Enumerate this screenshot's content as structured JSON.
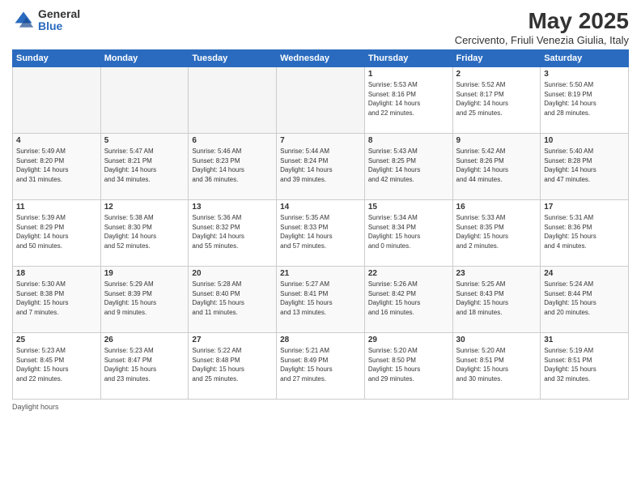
{
  "logo": {
    "general": "General",
    "blue": "Blue"
  },
  "title": "May 2025",
  "subtitle": "Cercivento, Friuli Venezia Giulia, Italy",
  "days_of_week": [
    "Sunday",
    "Monday",
    "Tuesday",
    "Wednesday",
    "Thursday",
    "Friday",
    "Saturday"
  ],
  "footer": "Daylight hours",
  "weeks": [
    [
      {
        "day": "",
        "info": ""
      },
      {
        "day": "",
        "info": ""
      },
      {
        "day": "",
        "info": ""
      },
      {
        "day": "",
        "info": ""
      },
      {
        "day": "1",
        "info": "Sunrise: 5:53 AM\nSunset: 8:16 PM\nDaylight: 14 hours\nand 22 minutes."
      },
      {
        "day": "2",
        "info": "Sunrise: 5:52 AM\nSunset: 8:17 PM\nDaylight: 14 hours\nand 25 minutes."
      },
      {
        "day": "3",
        "info": "Sunrise: 5:50 AM\nSunset: 8:19 PM\nDaylight: 14 hours\nand 28 minutes."
      }
    ],
    [
      {
        "day": "4",
        "info": "Sunrise: 5:49 AM\nSunset: 8:20 PM\nDaylight: 14 hours\nand 31 minutes."
      },
      {
        "day": "5",
        "info": "Sunrise: 5:47 AM\nSunset: 8:21 PM\nDaylight: 14 hours\nand 34 minutes."
      },
      {
        "day": "6",
        "info": "Sunrise: 5:46 AM\nSunset: 8:23 PM\nDaylight: 14 hours\nand 36 minutes."
      },
      {
        "day": "7",
        "info": "Sunrise: 5:44 AM\nSunset: 8:24 PM\nDaylight: 14 hours\nand 39 minutes."
      },
      {
        "day": "8",
        "info": "Sunrise: 5:43 AM\nSunset: 8:25 PM\nDaylight: 14 hours\nand 42 minutes."
      },
      {
        "day": "9",
        "info": "Sunrise: 5:42 AM\nSunset: 8:26 PM\nDaylight: 14 hours\nand 44 minutes."
      },
      {
        "day": "10",
        "info": "Sunrise: 5:40 AM\nSunset: 8:28 PM\nDaylight: 14 hours\nand 47 minutes."
      }
    ],
    [
      {
        "day": "11",
        "info": "Sunrise: 5:39 AM\nSunset: 8:29 PM\nDaylight: 14 hours\nand 50 minutes."
      },
      {
        "day": "12",
        "info": "Sunrise: 5:38 AM\nSunset: 8:30 PM\nDaylight: 14 hours\nand 52 minutes."
      },
      {
        "day": "13",
        "info": "Sunrise: 5:36 AM\nSunset: 8:32 PM\nDaylight: 14 hours\nand 55 minutes."
      },
      {
        "day": "14",
        "info": "Sunrise: 5:35 AM\nSunset: 8:33 PM\nDaylight: 14 hours\nand 57 minutes."
      },
      {
        "day": "15",
        "info": "Sunrise: 5:34 AM\nSunset: 8:34 PM\nDaylight: 15 hours\nand 0 minutes."
      },
      {
        "day": "16",
        "info": "Sunrise: 5:33 AM\nSunset: 8:35 PM\nDaylight: 15 hours\nand 2 minutes."
      },
      {
        "day": "17",
        "info": "Sunrise: 5:31 AM\nSunset: 8:36 PM\nDaylight: 15 hours\nand 4 minutes."
      }
    ],
    [
      {
        "day": "18",
        "info": "Sunrise: 5:30 AM\nSunset: 8:38 PM\nDaylight: 15 hours\nand 7 minutes."
      },
      {
        "day": "19",
        "info": "Sunrise: 5:29 AM\nSunset: 8:39 PM\nDaylight: 15 hours\nand 9 minutes."
      },
      {
        "day": "20",
        "info": "Sunrise: 5:28 AM\nSunset: 8:40 PM\nDaylight: 15 hours\nand 11 minutes."
      },
      {
        "day": "21",
        "info": "Sunrise: 5:27 AM\nSunset: 8:41 PM\nDaylight: 15 hours\nand 13 minutes."
      },
      {
        "day": "22",
        "info": "Sunrise: 5:26 AM\nSunset: 8:42 PM\nDaylight: 15 hours\nand 16 minutes."
      },
      {
        "day": "23",
        "info": "Sunrise: 5:25 AM\nSunset: 8:43 PM\nDaylight: 15 hours\nand 18 minutes."
      },
      {
        "day": "24",
        "info": "Sunrise: 5:24 AM\nSunset: 8:44 PM\nDaylight: 15 hours\nand 20 minutes."
      }
    ],
    [
      {
        "day": "25",
        "info": "Sunrise: 5:23 AM\nSunset: 8:45 PM\nDaylight: 15 hours\nand 22 minutes."
      },
      {
        "day": "26",
        "info": "Sunrise: 5:23 AM\nSunset: 8:47 PM\nDaylight: 15 hours\nand 23 minutes."
      },
      {
        "day": "27",
        "info": "Sunrise: 5:22 AM\nSunset: 8:48 PM\nDaylight: 15 hours\nand 25 minutes."
      },
      {
        "day": "28",
        "info": "Sunrise: 5:21 AM\nSunset: 8:49 PM\nDaylight: 15 hours\nand 27 minutes."
      },
      {
        "day": "29",
        "info": "Sunrise: 5:20 AM\nSunset: 8:50 PM\nDaylight: 15 hours\nand 29 minutes."
      },
      {
        "day": "30",
        "info": "Sunrise: 5:20 AM\nSunset: 8:51 PM\nDaylight: 15 hours\nand 30 minutes."
      },
      {
        "day": "31",
        "info": "Sunrise: 5:19 AM\nSunset: 8:51 PM\nDaylight: 15 hours\nand 32 minutes."
      }
    ]
  ]
}
